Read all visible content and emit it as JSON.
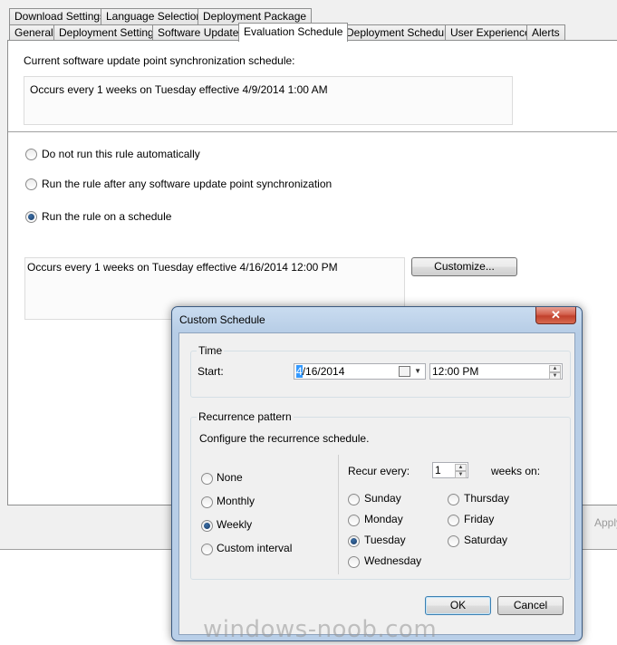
{
  "tabs_row1": [
    "Download Settings",
    "Language Selection",
    "Deployment Package"
  ],
  "tabs_row2": [
    "General",
    "Deployment Settings",
    "Software Updates",
    "Evaluation Schedule",
    "Deployment Schedule",
    "User Experience",
    "Alerts"
  ],
  "active_tab": "Evaluation Schedule",
  "sync": {
    "label": "Current software update point synchronization schedule:",
    "text": "Occurs every 1 weeks on Tuesday effective 4/9/2014 1:00 AM"
  },
  "options": {
    "do_not_run": "Do not run this rule automatically",
    "after_sync": "Run the rule after any software update point synchronization",
    "on_schedule": "Run the rule on a schedule",
    "selected": "on_schedule"
  },
  "schedule": {
    "text": "Occurs every 1 weeks on Tuesday effective 4/16/2014 12:00 PM",
    "customize_label": "Customize..."
  },
  "apply_label": "Apply",
  "dialog": {
    "title": "Custom Schedule",
    "close_glyph": "✕",
    "time_group": "Time",
    "start_label": "Start:",
    "start_date_sel": "4",
    "start_date_rest": "/16/2014",
    "start_time": "12:00 PM",
    "recurrence_group": "Recurrence pattern",
    "configure_text": "Configure the recurrence schedule.",
    "patterns": [
      "None",
      "Monthly",
      "Weekly",
      "Custom interval"
    ],
    "selected_pattern": "Weekly",
    "recur_every_label": "Recur every:",
    "recur_value": "1",
    "weeks_on_label": "weeks on:",
    "days_col1": [
      "Sunday",
      "Monday",
      "Tuesday",
      "Wednesday"
    ],
    "days_col2": [
      "Thursday",
      "Friday",
      "Saturday"
    ],
    "selected_day": "Tuesday",
    "ok_label": "OK",
    "cancel_label": "Cancel"
  },
  "watermark": "windows-noob.com",
  "colors": {
    "selection": "#3399ff",
    "titlebar": "#b9cfe8",
    "close_button": "#c1402c"
  }
}
